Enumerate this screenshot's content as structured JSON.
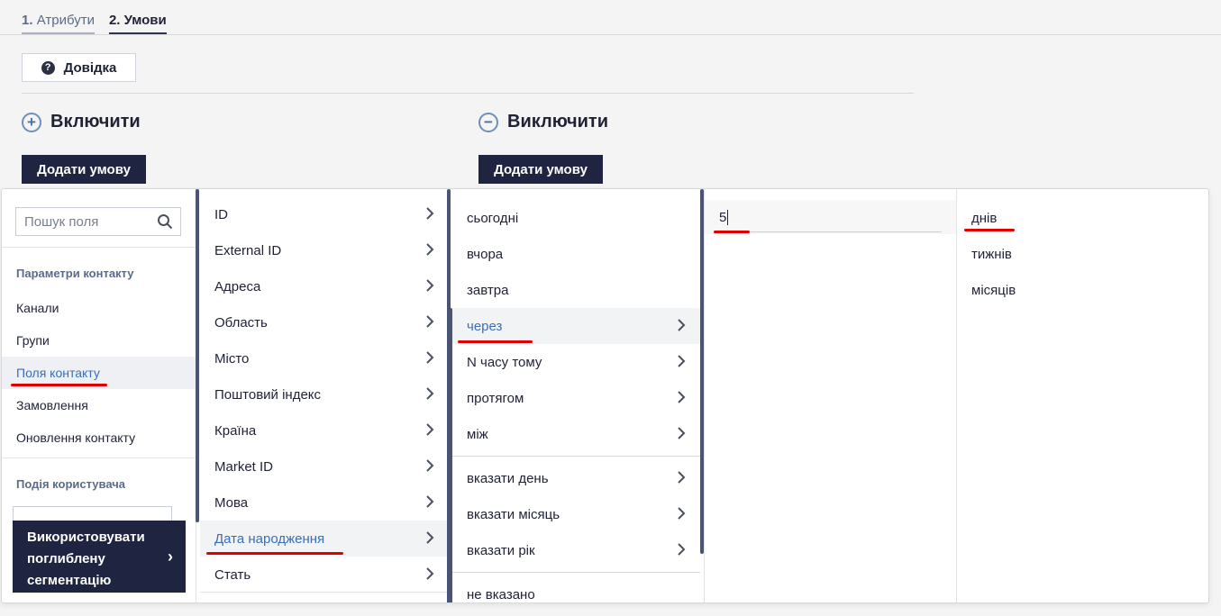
{
  "tabs": [
    {
      "num": "1.",
      "label": "Атрибути"
    },
    {
      "num": "2.",
      "label": "Умови"
    }
  ],
  "help_button": {
    "label": "Довідка",
    "icon": "question-circle-icon"
  },
  "include": {
    "title": "Включити",
    "icon": "plus-circle-icon",
    "button": "Додати умову"
  },
  "exclude": {
    "title": "Виключити",
    "icon": "minus-circle-icon",
    "button": "Додати умову"
  },
  "field_picker": {
    "search": {
      "placeholder": "Пошук поля",
      "icon": "search-icon"
    },
    "group1_title": "Параметри контакту",
    "group1_items": [
      "Канали",
      "Групи",
      "Поля контакту",
      "Замовлення",
      "Оновлення контакту"
    ],
    "group1_selected": "Поля контакту",
    "group2_title": "Подія користувача",
    "deep_segmentation_button": "Використовувати поглиблену сегментацію"
  },
  "fields": {
    "items": [
      "ID",
      "External ID",
      "Адреса",
      "Область",
      "Місто",
      "Поштовий індекс",
      "Країна",
      "Market ID",
      "Мова",
      "Дата народження",
      "Стать"
    ],
    "selected": "Дата народження"
  },
  "date_conditions": {
    "group1": [
      "сьогодні",
      "вчора",
      "завтра",
      "через",
      "N часу тому",
      "протягом",
      "між"
    ],
    "group2": [
      "вказати день",
      "вказати місяць",
      "вказати рік"
    ],
    "group3": [
      "не вказано"
    ],
    "selected": "через"
  },
  "amount_input": {
    "value": "5"
  },
  "units": {
    "items": [
      "днів",
      "тижнів",
      "місяців"
    ],
    "selected": "днів"
  },
  "colors": {
    "accent": "#3a6fb8",
    "dark_button": "#1f2540",
    "highlight_mark": "#e00000"
  }
}
